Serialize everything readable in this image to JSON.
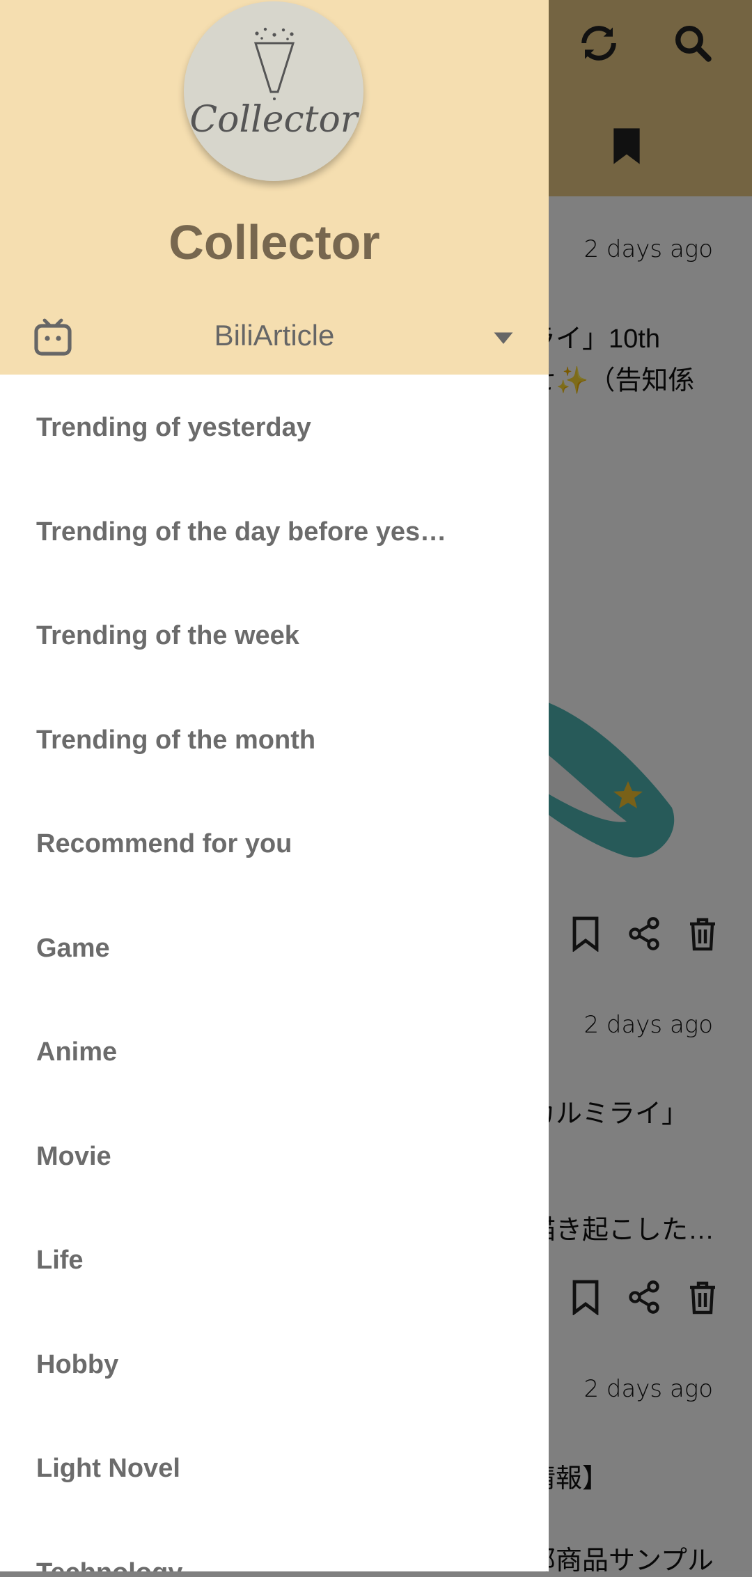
{
  "app_background": {
    "toolbar": {
      "refresh_icon": "refresh-icon",
      "search_icon": "search-icon",
      "bookmark_tab_icon": "bookmark-icon"
    },
    "cards": [
      {
        "time": "2 days ago",
        "title_lines": [
          "ライ」10th",
          "せ✨（告知係"
        ]
      },
      {
        "time": "2 days ago",
        "title_lines": [
          "カルミライ」",
          "描き起こした…"
        ]
      },
      {
        "time": "2 days ago",
        "title_lines": [
          "情報】",
          "部商品サンプル"
        ]
      }
    ]
  },
  "drawer": {
    "app_title": "Collector",
    "logo_text": "Collector",
    "source": {
      "icon": "tv-icon",
      "label": "BiliArticle"
    },
    "menu": [
      {
        "label": "Trending of yesterday"
      },
      {
        "label": "Trending of the day before yest…"
      },
      {
        "label": "Trending of the week"
      },
      {
        "label": "Trending of the month"
      },
      {
        "label": "Recommend for you"
      },
      {
        "label": "Game"
      },
      {
        "label": "Anime"
      },
      {
        "label": "Movie"
      },
      {
        "label": "Life"
      },
      {
        "label": "Hobby"
      },
      {
        "label": "Light Novel"
      },
      {
        "label": "Technology"
      }
    ]
  },
  "colors": {
    "toolbar": "#e9c985",
    "drawer_header": "#f5deb0",
    "title_text": "#77674f",
    "menu_text": "#6b6b6b",
    "scrim": "rgba(0,0,0,0.5)"
  }
}
